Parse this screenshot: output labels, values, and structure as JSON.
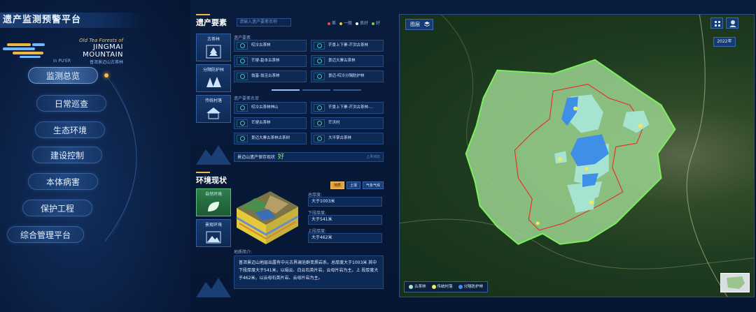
{
  "app": {
    "title": "遗产监测预警平台"
  },
  "logo": {
    "line1": "Old Tea Forests of",
    "line2": "JINGMAI MOUNTAIN",
    "line3_left": "in PU'ER",
    "line3_right": "普洱景迈山古茶林"
  },
  "menu": [
    {
      "label": "监测总览",
      "active": true
    },
    {
      "label": "日常巡查",
      "active": false
    },
    {
      "label": "生态环境",
      "active": false
    },
    {
      "label": "建设控制",
      "active": false
    },
    {
      "label": "本体病害",
      "active": false
    },
    {
      "label": "保护工程",
      "active": false
    },
    {
      "label": "综合管理平台",
      "active": false
    }
  ],
  "heritage": {
    "title": "遗产要素",
    "search_placeholder": "请输入遗产要素名称",
    "legend": [
      {
        "label": "差",
        "color": "#e84b4b"
      },
      {
        "label": "一般",
        "color": "#f0c341"
      },
      {
        "label": "良好",
        "color": "#ffffff"
      },
      {
        "label": "好",
        "color": "#6fd35a"
      }
    ],
    "tabs": [
      {
        "label": "古茶林"
      },
      {
        "label": "分隔防护林"
      },
      {
        "label": "传统村落"
      }
    ],
    "group1_label": "遗产要素",
    "group1": [
      "哎冷古茶林",
      "芒景上下寨-芒洪古茶林",
      "芒埂-勐本古茶林",
      "景迈大寨古茶林",
      "翁基-翁洼古茶林",
      "景迈-哎冷分隔防护林"
    ],
    "group2_label": "遗产要素名单",
    "group2": [
      "哎冷古茶林神山",
      "芒景上下寨-芒洪古茶林-...",
      "芒埂古茶林",
      "芒洪村",
      "景迈大寨古茶林古茶树",
      "大平掌古茶林"
    ],
    "status_text": "景迈山遗产保存现状",
    "status_value": "好",
    "status_more": "上月对比"
  },
  "environment": {
    "title": "环境现状",
    "tabs": [
      {
        "label": "地质",
        "active": true
      },
      {
        "label": "土壤",
        "active": false
      },
      {
        "label": "气象气候",
        "active": false
      }
    ],
    "side_tabs": [
      {
        "label": "自然环境"
      },
      {
        "label": "景观环境"
      }
    ],
    "fields": [
      {
        "label": "总厚度:",
        "value": "大于1003米"
      },
      {
        "label": "下段厚度:",
        "value": "大于541米"
      },
      {
        "label": "上段厚度:",
        "value": "大于462米"
      }
    ],
    "desc_title": "地质简介:",
    "desc": "普洱景迈山地层出露有中元古界澜沧群变质岩系，总厚度大于1003米 其中下段厚度大于541米，以绢云、白云石英片岩，云母片岩为主。上 段厚度大于462米，以云母石英片岩、云母片岩为主。"
  },
  "map": {
    "layer_label": "图层",
    "year": "2022年",
    "legend": [
      {
        "label": "古茶林",
        "color": "#a6e3d0"
      },
      {
        "label": "传统村落",
        "color": "#f1ea5a"
      },
      {
        "label": "分隔防护林",
        "color": "#3f8fe6"
      }
    ],
    "zone_colors": {
      "outer": "#9ad38f",
      "outer_edge": "#7af05a",
      "inner_edge": "#e5332a",
      "tea": "#a6e3d0",
      "forest": "#3f8fe6",
      "village": "#f1ea5a"
    }
  }
}
